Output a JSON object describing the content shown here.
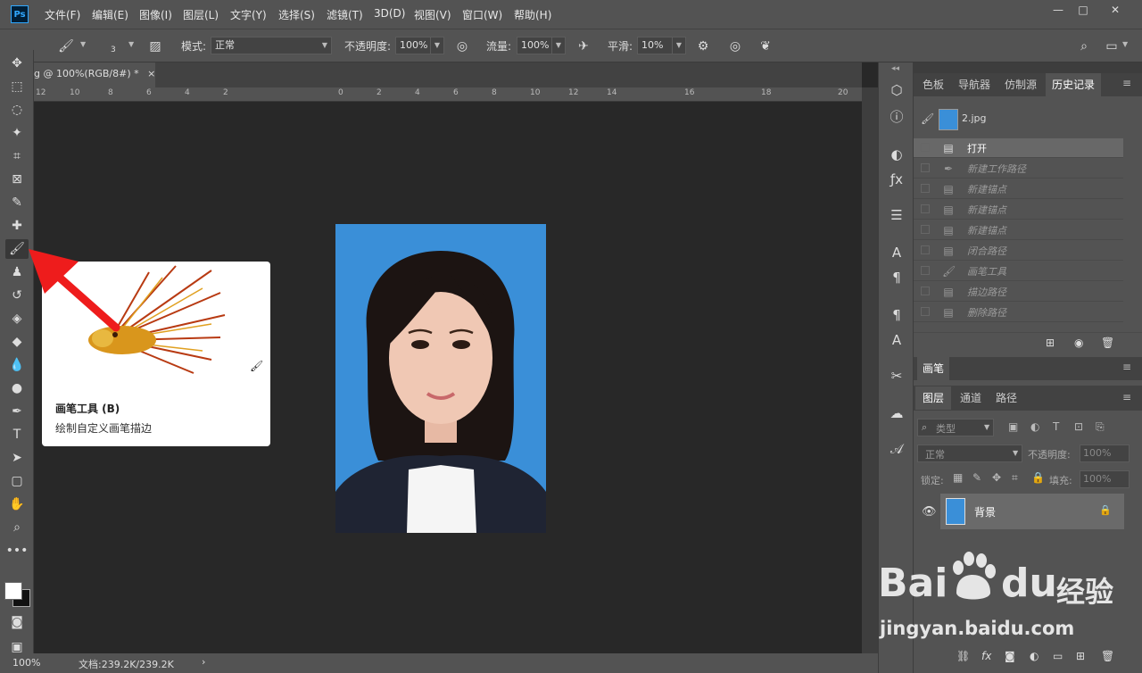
{
  "menubar": {
    "logo": "Ps",
    "items": [
      "文件(F)",
      "编辑(E)",
      "图像(I)",
      "图层(L)",
      "文字(Y)",
      "选择(S)",
      "滤镜(T)",
      "3D(D)",
      "视图(V)",
      "窗口(W)",
      "帮助(H)"
    ],
    "window_controls": {
      "minimize": "—",
      "restore": "□",
      "close": "✕"
    }
  },
  "options": {
    "brush_size": "3",
    "mode_label": "模式:",
    "mode_value": "正常",
    "opacity_label": "不透明度:",
    "opacity_value": "100%",
    "flow_label": "流量:",
    "flow_value": "100%",
    "smooth_label": "平滑:",
    "smooth_value": "10%"
  },
  "document": {
    "tab_title": "g @ 100%(RGB/8#) *",
    "tab_close": "×",
    "ruler_ticks": [
      "12",
      "10",
      "8",
      "6",
      "4",
      "2",
      "0",
      "2",
      "4",
      "6",
      "8",
      "10",
      "12",
      "14",
      "16",
      "18",
      "20"
    ]
  },
  "tooltip": {
    "title": "画笔工具 (B)",
    "description": "绘制自定义画笔描边"
  },
  "status": {
    "zoom": "100%",
    "doc_info": "文档:239.2K/239.2K",
    "arrow": "›"
  },
  "history_panel": {
    "tabs": [
      "色板",
      "导航器",
      "仿制源",
      "历史记录"
    ],
    "active_tab": "历史记录",
    "snapshot_name": "2.jpg",
    "items": [
      "打开",
      "新建工作路径",
      "新建锚点",
      "新建锚点",
      "新建锚点",
      "闭合路径",
      "画笔工具",
      "描边路径",
      "删除路径"
    ]
  },
  "brush_panel": {
    "title": "画笔"
  },
  "layers_panel": {
    "tabs": [
      "图层",
      "通道",
      "路径"
    ],
    "filter_placeholder": "类型",
    "blend_mode": "正常",
    "opacity_label": "不透明度:",
    "opacity_value": "100%",
    "lock_label": "锁定:",
    "fill_label": "填充:",
    "fill_value": "100%",
    "layer_name": "背景"
  },
  "watermark": {
    "brand": "Bai",
    "brand2": "du",
    "cn": "经验",
    "url": "jingyan.baidu.com"
  },
  "colors": {
    "panel_bg": "#535353",
    "canvas_bg": "#282828",
    "photo_bg": "#3a8fd8",
    "arrow_red": "#ee1c1c"
  }
}
